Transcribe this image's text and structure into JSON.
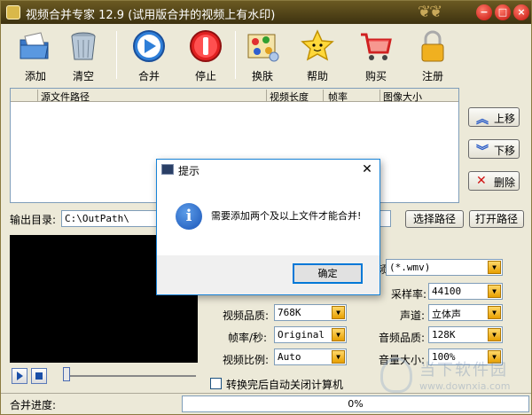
{
  "window": {
    "title": "视频合并专家 12.9 (试用版合并的视频上有水印)"
  },
  "toolbar": {
    "items": [
      {
        "label": "添加",
        "icon": "add-folder-icon"
      },
      {
        "label": "清空",
        "icon": "trash-can-icon"
      },
      {
        "label": "合并",
        "icon": "play-merge-icon"
      },
      {
        "label": "停止",
        "icon": "stop-icon"
      },
      {
        "label": "换肤",
        "icon": "skin-palette-icon"
      },
      {
        "label": "帮助",
        "icon": "help-star-icon"
      },
      {
        "label": "购买",
        "icon": "shopping-cart-icon"
      },
      {
        "label": "注册",
        "icon": "padlock-icon"
      }
    ]
  },
  "filelist": {
    "columns": [
      "源文件路径",
      "视频长度",
      "帧率",
      "图像大小"
    ]
  },
  "side_buttons": {
    "up": "上移",
    "down": "下移",
    "delete": "删除"
  },
  "output": {
    "label": "输出目录:",
    "path": "C:\\OutPath\\",
    "choose_label": "选择路径",
    "open_label": "打开路径"
  },
  "settings": {
    "format_value": "(*.wmv)",
    "format_label_fragment": "频",
    "sample_rate_label": "采样率:",
    "sample_rate_value": "44100",
    "video_quality_label": "视频品质:",
    "video_quality_value": "768K",
    "channel_label": "声道:",
    "channel_value": "立体声",
    "fps_label": "帧率/秒:",
    "fps_value": "Original",
    "audio_quality_label": "音频品质:",
    "audio_quality_value": "128K",
    "aspect_label": "视频比例:",
    "aspect_value": "Auto",
    "volume_label": "音量大小:",
    "volume_value": "100%"
  },
  "shutdown_checkbox": {
    "label": "转换完后自动关闭计算机",
    "checked": false
  },
  "status": {
    "label": "合并进度:",
    "progress": "0%"
  },
  "watermark": {
    "cn": "当下软件园",
    "url": "www.downxia.com"
  },
  "dialog": {
    "title": "提示",
    "message": "需要添加两个及以上文件才能合并!",
    "ok_label": "确定"
  }
}
